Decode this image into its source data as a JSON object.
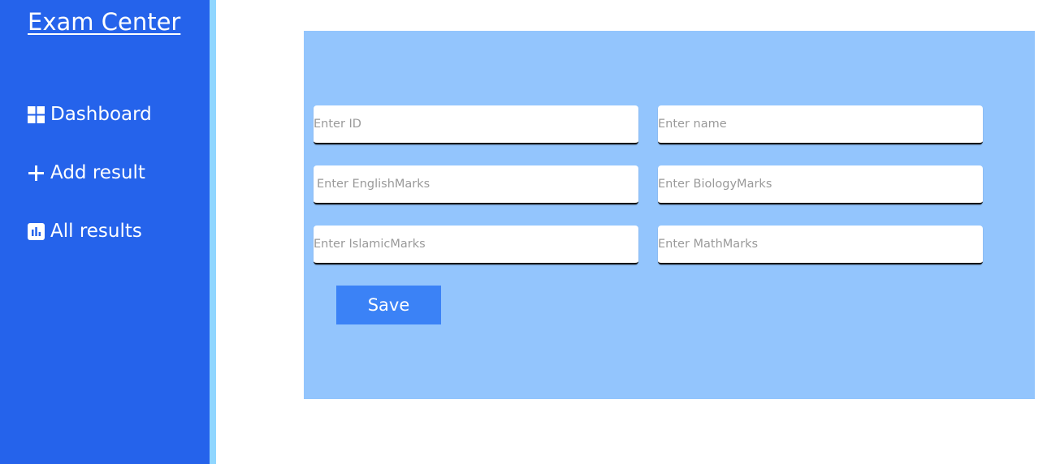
{
  "sidebar": {
    "brand": "Exam Center",
    "items": [
      {
        "label": "Dashboard",
        "icon": "grid-icon"
      },
      {
        "label": "Add result",
        "icon": "plus-icon"
      },
      {
        "label": "All results",
        "icon": "bar-chart-icon"
      }
    ]
  },
  "form": {
    "fields": [
      {
        "placeholder": "Enter ID",
        "value": ""
      },
      {
        "placeholder": "Enter name",
        "value": ""
      },
      {
        "placeholder": "Enter EnglishMarks",
        "value": ""
      },
      {
        "placeholder": "Enter BiologyMarks",
        "value": ""
      },
      {
        "placeholder": "Enter IslamicMarks",
        "value": ""
      },
      {
        "placeholder": "Enter MathMarks",
        "value": ""
      }
    ],
    "save_label": "Save"
  },
  "colors": {
    "sidebar": "#2563eb",
    "sidebar_edge": "#8fd6ff",
    "panel": "#93c5fd",
    "button": "#3b82f6"
  }
}
